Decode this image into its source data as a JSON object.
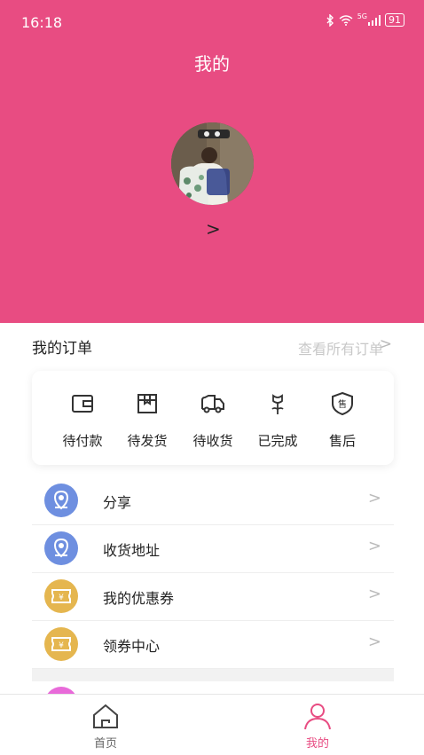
{
  "status_bar": {
    "time": "16:18",
    "network": "5G",
    "battery": "91"
  },
  "header": {
    "title": "我的",
    "profile_chevron": ">"
  },
  "orders": {
    "title": "我的订单",
    "view_all": "查看所有订单",
    "view_all_chevron": ">",
    "items": [
      {
        "label": "待付款",
        "icon": "wallet-icon"
      },
      {
        "label": "待发货",
        "icon": "package-icon"
      },
      {
        "label": "待收货",
        "icon": "truck-icon"
      },
      {
        "label": "已完成",
        "icon": "flower-icon"
      },
      {
        "label": "售后",
        "icon": "shield-icon",
        "icon_text": "售"
      }
    ]
  },
  "menu": [
    {
      "label": "分享",
      "icon": "location-pin-icon",
      "icon_color": "#6e8fe0"
    },
    {
      "label": "收货地址",
      "icon": "location-pin-icon",
      "icon_color": "#6e8fe0"
    },
    {
      "label": "我的优惠券",
      "icon": "coupon-icon",
      "icon_color": "#e5b64f",
      "icon_text": "¥"
    },
    {
      "label": "领券中心",
      "icon": "coupon-icon",
      "icon_color": "#e5b64f",
      "icon_text": "¥"
    }
  ],
  "menu_chevron": ">",
  "tabbar": {
    "items": [
      {
        "label": "首页",
        "icon": "home-icon",
        "active": false
      },
      {
        "label": "我的",
        "icon": "user-icon",
        "active": true
      }
    ]
  },
  "colors": {
    "brand": "#e84c82",
    "text": "#222222",
    "muted": "#c8c8c8",
    "tab_inactive": "#666666"
  }
}
